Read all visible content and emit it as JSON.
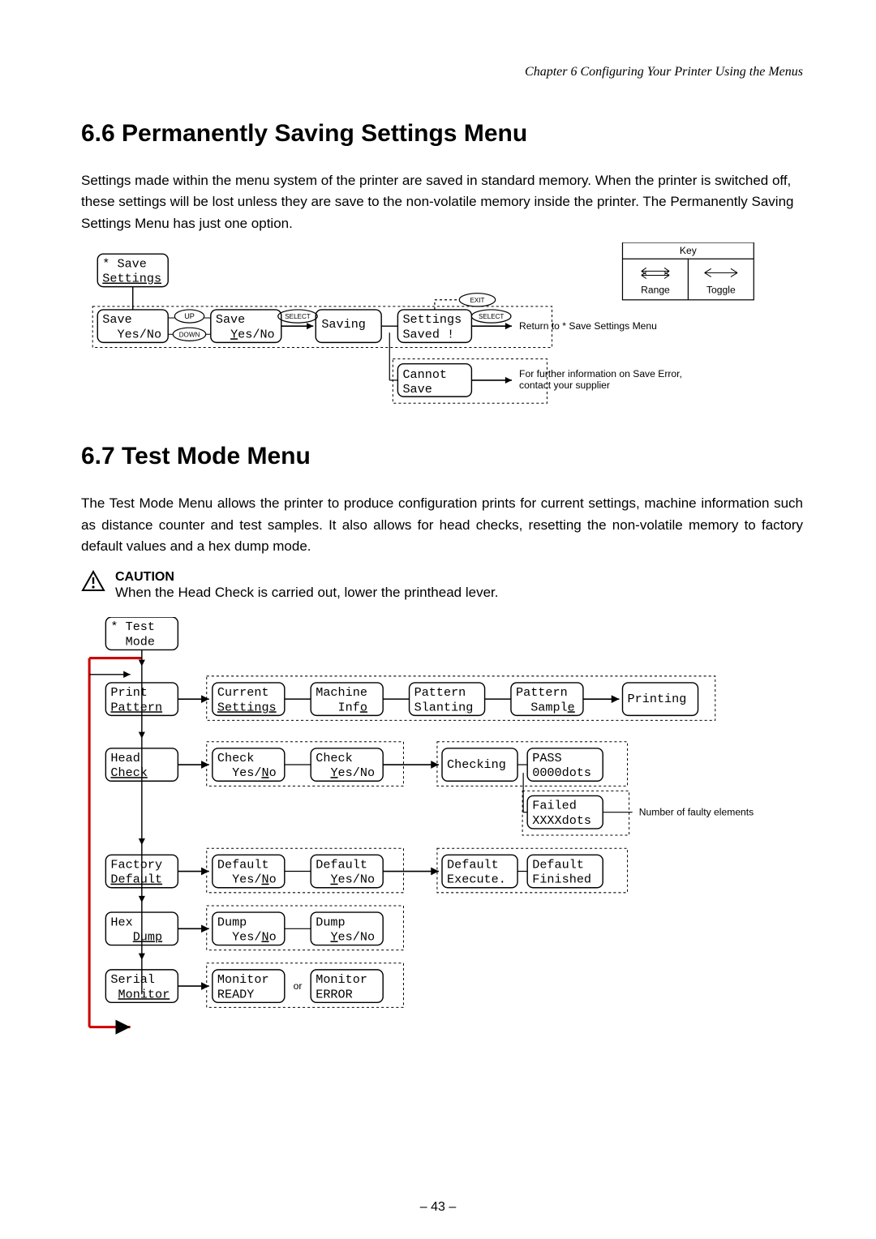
{
  "running_head": "Chapter 6   Configuring Your Printer Using the Menus",
  "section66": {
    "heading": "6.6   Permanently Saving Settings Menu",
    "para": "Settings made within the menu system of the printer are saved in standard memory. When the printer is switched off, these settings will be lost unless they are save to the non-volatile memory inside the printer. The Permanently Saving Settings Menu has just one option."
  },
  "diagram66": {
    "key_title": "Key",
    "key_range": "Range",
    "key_toggle": "Toggle",
    "box_save_settings_l1": "* Save",
    "box_save_settings_l2": "Settings",
    "box_save_yesno_l1": "Save",
    "box_save_yesno_l2": "  Yes/No",
    "box_save_yesno2_l1": "Save",
    "box_save_yesno2_l2": "  Yes/No",
    "btn_up": "UP",
    "btn_down": "DOWN",
    "btn_select": "SELECT",
    "btn_select2": "SELECT",
    "btn_exit": "EXIT",
    "box_saving": "Saving",
    "box_settings_saved_l1": "Settings",
    "box_settings_saved_l2": "Saved !",
    "txt_return": "Return to * Save Settings Menu",
    "box_cannot_l1": "Cannot",
    "box_cannot_l2": "Save",
    "txt_error": "For further information on Save Error, contact your supplier"
  },
  "section67": {
    "heading": "6.7   Test Mode Menu",
    "para": "The Test Mode Menu allows the printer to produce configuration prints for current settings, machine information such as distance counter and test samples. It also allows for head checks, resetting the non-volatile memory to factory default values and a hex dump mode.",
    "caution_label": "CAUTION",
    "caution_text": "When the Head Check is carried out, lower the printhead lever."
  },
  "diagram67": {
    "box_test_l1": "* Test",
    "box_test_l2": "  Mode",
    "row1": {
      "c1_l1": "Print",
      "c1_l2": "Pattern",
      "c2_l1": "Current",
      "c2_l2": "Settings",
      "c3_l1": "Machine",
      "c3_l2": "   Info",
      "c4_l1": "Pattern",
      "c4_l2": "Slanting",
      "c5_l1": "Pattern",
      "c5_l2": "  Sample",
      "c6": "Printing"
    },
    "row2": {
      "c1_l1": "Head",
      "c1_l2": "Check",
      "c2_l1": "Check",
      "c2_l2": "  Yes/No",
      "c3_l1": "Check",
      "c3_l2": "  Yes/No",
      "c4": "Checking",
      "c5_l1": "PASS",
      "c5_l2": "0000dots",
      "c6_l1": "Failed",
      "c6_l2": "XXXXdots",
      "note": "Number of faulty elements"
    },
    "row3": {
      "c1_l1": "Factory",
      "c1_l2": "Default",
      "c2_l1": "Default",
      "c2_l2": "  Yes/No",
      "c3_l1": "Default",
      "c3_l2": "  Yes/No",
      "c4_l1": "Default",
      "c4_l2": "Execute.",
      "c5_l1": "Default",
      "c5_l2": "Finished"
    },
    "row4": {
      "c1_l1": "Hex",
      "c1_l2": "   Dump",
      "c2_l1": "Dump",
      "c2_l2": "  Yes/No",
      "c3_l1": "Dump",
      "c3_l2": "  Yes/No"
    },
    "row5": {
      "c1_l1": "Serial",
      "c1_l2": " Monitor",
      "c2_l1": "Monitor",
      "c2_l2": "READY",
      "or": "or",
      "c3_l1": "Monitor",
      "c3_l2": "ERROR"
    }
  },
  "page_num": "– 43 –"
}
